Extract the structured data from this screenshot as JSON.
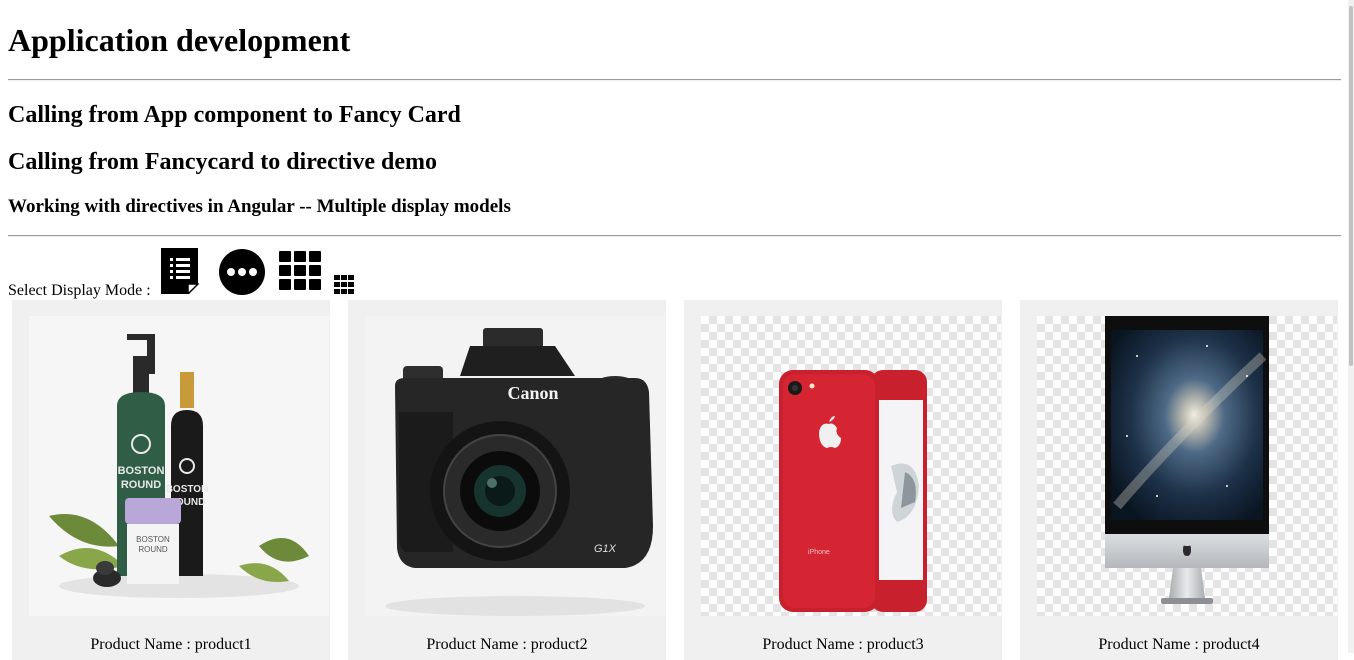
{
  "header": {
    "title": "Application development"
  },
  "sections": {
    "app_to_card": "Calling from App component to Fancy Card",
    "card_to_directive": "Calling from Fancycard to directive demo",
    "directives_subtitle": "Working with directives in Angular -- Multiple display models"
  },
  "display_mode": {
    "label": "Select Display Mode :",
    "options": [
      {
        "icon": "list-document-icon"
      },
      {
        "icon": "more-horizontal-circle-icon"
      },
      {
        "icon": "large-grid-icon"
      },
      {
        "icon": "small-grid-icon"
      }
    ]
  },
  "products": [
    {
      "caption": "Product Name : product1",
      "image": "cosmetics-bottles-image"
    },
    {
      "caption": "Product Name : product2",
      "image": "canon-camera-image"
    },
    {
      "caption": "Product Name : product3",
      "image": "red-iphone-image"
    },
    {
      "caption": "Product Name : product4",
      "image": "imac-desktop-image"
    }
  ],
  "image_text": {
    "bottle_brand": "BOSTON",
    "bottle_line": "ROUND",
    "camera_brand": "Canon",
    "camera_model": "G1X",
    "phone_brand": "iPhone"
  },
  "colors": {
    "card_bg": "#f0f0f0",
    "divider": "#9a9a9a",
    "phone_red": "#c8202c"
  }
}
